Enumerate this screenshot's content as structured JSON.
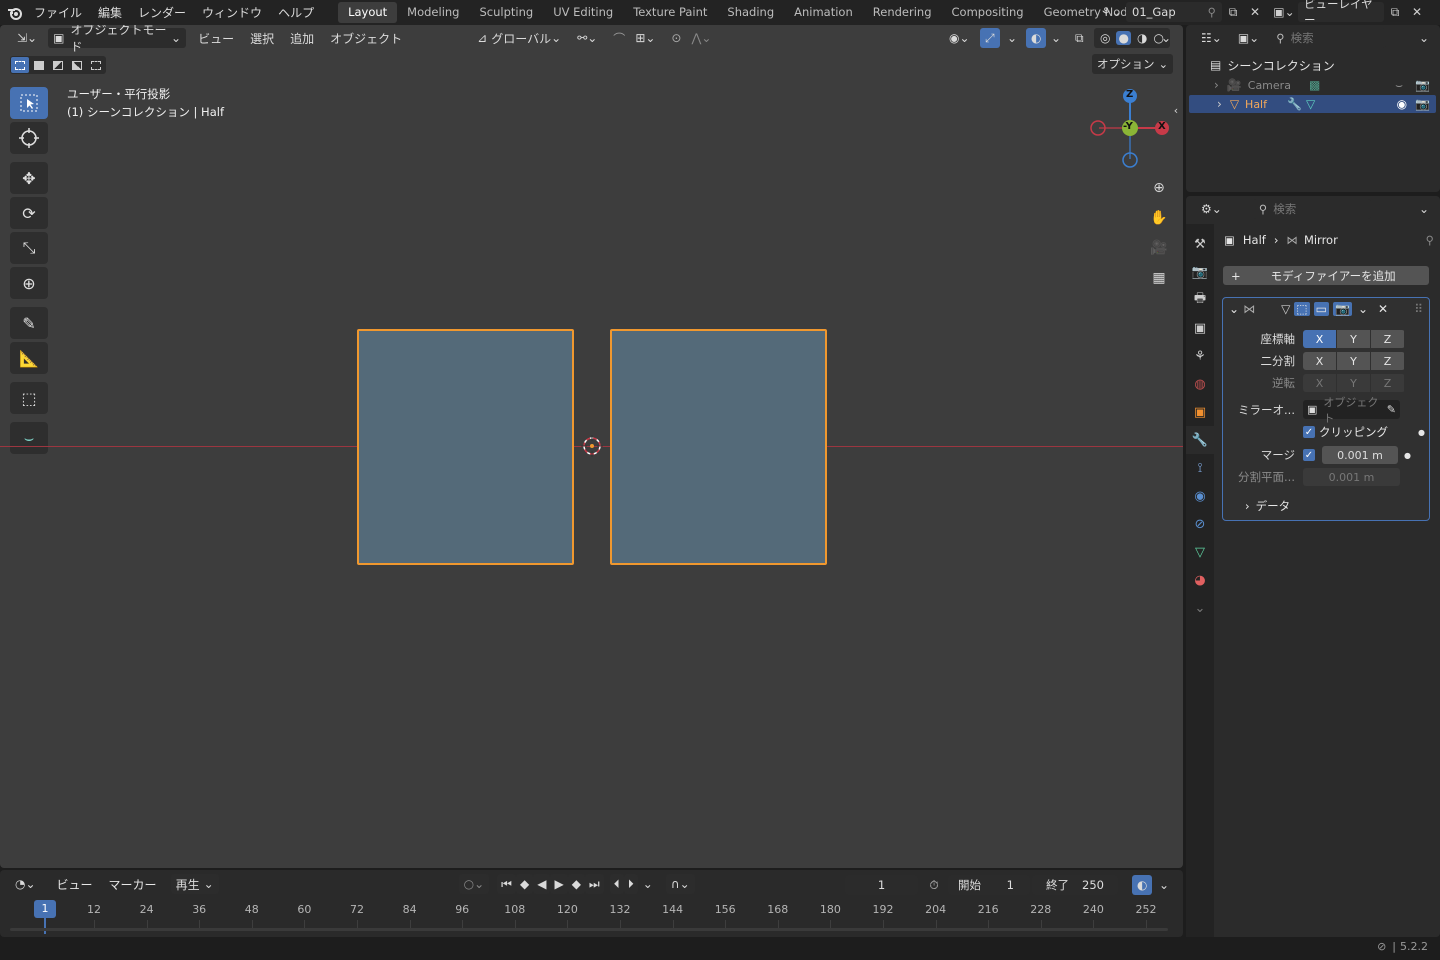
{
  "topbar": {
    "menus": [
      "ファイル",
      "編集",
      "レンダー",
      "ウィンドウ",
      "ヘルプ"
    ],
    "workspaces": [
      "Layout",
      "Modeling",
      "Sculpting",
      "UV Editing",
      "Texture Paint",
      "Shading",
      "Animation",
      "Rendering",
      "Compositing",
      "Geometry Nodes"
    ],
    "active_workspace": "Layout",
    "scene_name": "01_Gap",
    "view_layer": "ビューレイヤー"
  },
  "viewport": {
    "mode": "オブジェクトモード",
    "menus": [
      "ビュー",
      "選択",
      "追加",
      "オブジェクト"
    ],
    "transform_orientation": "グローバル",
    "options_label": "オプション",
    "view_name": "ユーザー・平行投影",
    "collection_info": "(1) シーンコレクション | Half",
    "gizmo": {
      "z": "Z",
      "y": "-Y",
      "x": "X"
    }
  },
  "timeline": {
    "menus": [
      "ビュー",
      "マーカー"
    ],
    "playback": "再生",
    "current_frame": "1",
    "start_label": "開始",
    "start_value": "1",
    "end_label": "終了",
    "end_value": "250",
    "frame_marker": "1",
    "ticks": [
      "12",
      "24",
      "36",
      "48",
      "60",
      "72",
      "84",
      "96",
      "108",
      "120",
      "132",
      "144",
      "156",
      "168",
      "180",
      "192",
      "204",
      "216",
      "228",
      "240",
      "252"
    ]
  },
  "outliner": {
    "search_placeholder": "検索",
    "root": "シーンコレクション",
    "items": [
      {
        "name": "Camera",
        "selected": false
      },
      {
        "name": "Half",
        "selected": true
      }
    ]
  },
  "properties": {
    "search_placeholder": "検索",
    "breadcrumb_object": "Half",
    "breadcrumb_modifier": "Mirror",
    "add_modifier": "モディファイアーを追加",
    "axis_label": "座標軸",
    "bisect_label": "二分割",
    "flip_label": "逆転",
    "axes": [
      "X",
      "Y",
      "Z"
    ],
    "mirror_object_label": "ミラーオ...",
    "mirror_object_placeholder": "オブジェクト",
    "clipping_label": "クリッピング",
    "merge_label": "マージ",
    "merge_value": "0.001 m",
    "bisect_distance_label": "分割平面...",
    "bisect_distance_value": "0.001 m",
    "data_label": "データ"
  },
  "status": {
    "version": "5.2.2"
  },
  "colors": {
    "accent": "#4772b3",
    "selection_outline": "#f0982f",
    "mesh_face": "#546a79",
    "x_axis": "#c73a48",
    "y_axis": "#8bb536",
    "z_axis": "#3b7fd1"
  }
}
